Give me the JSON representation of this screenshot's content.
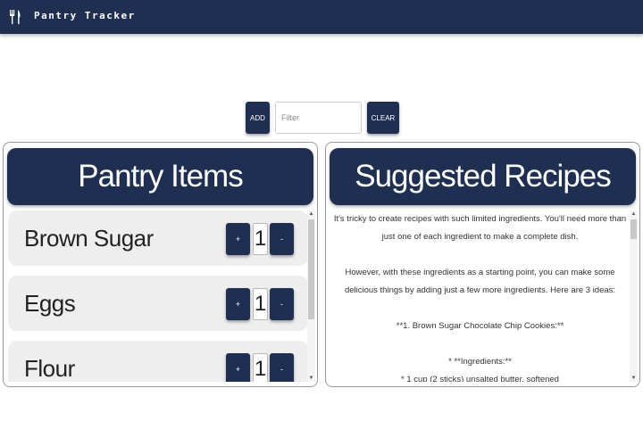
{
  "app": {
    "title": "Pantry Tracker",
    "logo_icon": "fork-knife-icon"
  },
  "toolbar": {
    "add_label": "ADD",
    "filter_placeholder": "Filter",
    "filter_value": "",
    "clear_label": "CLEAR"
  },
  "pantry": {
    "heading": "Pantry Items",
    "items": [
      {
        "name": "Brown Sugar",
        "quantity": "1",
        "plus_label": "+",
        "minus_label": "-"
      },
      {
        "name": "Eggs",
        "quantity": "1",
        "plus_label": "+",
        "minus_label": "-"
      },
      {
        "name": "Flour",
        "quantity": "1",
        "plus_label": "+",
        "minus_label": "-"
      }
    ]
  },
  "recipes": {
    "heading": "Suggested Recipes",
    "paragraphs": [
      "It's tricky to create recipes with such limited ingredients. You'll need more than just one of each ingredient to make a complete dish.",
      "However, with these ingredients as a starting point, you can make some delicious things by adding just a few more ingredients. Here are 3 ideas:",
      "**1. Brown Sugar Chocolate Chip Cookies:**",
      "* **Ingredients:**",
      "* 1 cup (2 sticks) unsalted butter, softened"
    ]
  },
  "colors": {
    "primary": "#1e2f52",
    "item_background": "#eeeeee"
  }
}
